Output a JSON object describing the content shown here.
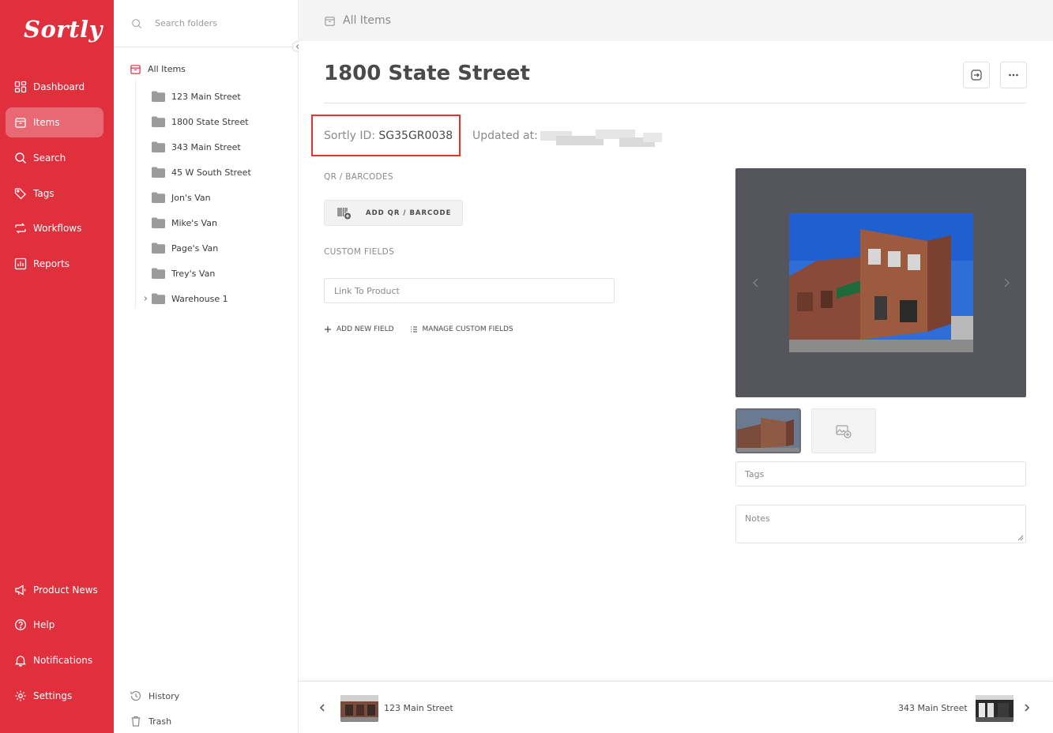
{
  "brand": {
    "logo": "Sortly",
    "accent": "#e0303d"
  },
  "nav": {
    "top": [
      {
        "label": "Dashboard",
        "icon": "dashboard-icon"
      },
      {
        "label": "Items",
        "icon": "items-icon",
        "active": true
      },
      {
        "label": "Search",
        "icon": "search-icon"
      },
      {
        "label": "Tags",
        "icon": "tag-icon"
      },
      {
        "label": "Workflows",
        "icon": "workflows-icon"
      },
      {
        "label": "Reports",
        "icon": "reports-icon"
      }
    ],
    "bottom": [
      {
        "label": "Product News",
        "icon": "megaphone-icon"
      },
      {
        "label": "Help",
        "icon": "help-icon"
      },
      {
        "label": "Notifications",
        "icon": "bell-icon"
      },
      {
        "label": "Settings",
        "icon": "gear-icon"
      }
    ]
  },
  "folders": {
    "search_placeholder": "Search folders",
    "root": "All Items",
    "items": [
      {
        "label": "123 Main Street"
      },
      {
        "label": "1800 State Street"
      },
      {
        "label": "343 Main Street"
      },
      {
        "label": "45 W South Street"
      },
      {
        "label": "Jon's Van"
      },
      {
        "label": "Mike's Van"
      },
      {
        "label": "Page's Van"
      },
      {
        "label": "Trey's Van"
      },
      {
        "label": "Warehouse 1",
        "expandable": true
      }
    ],
    "history": "History",
    "trash": "Trash"
  },
  "main": {
    "breadcrumb": "All Items",
    "title": "1800 State Street",
    "sortly_id_label": "Sortly ID:",
    "sortly_id": "SG35GR0038",
    "updated_label": "Updated at:",
    "qr_section": "QR / BARCODES",
    "add_qr": "ADD QR / BARCODE",
    "custom_section": "CUSTOM FIELDS",
    "custom_field_placeholder": "Link To Product",
    "add_field": "ADD NEW FIELD",
    "manage_fields": "MANAGE CUSTOM FIELDS",
    "tags_placeholder": "Tags",
    "notes_placeholder": "Notes"
  },
  "footer": {
    "prev_label": "123 Main Street",
    "next_label": "343 Main Street"
  }
}
